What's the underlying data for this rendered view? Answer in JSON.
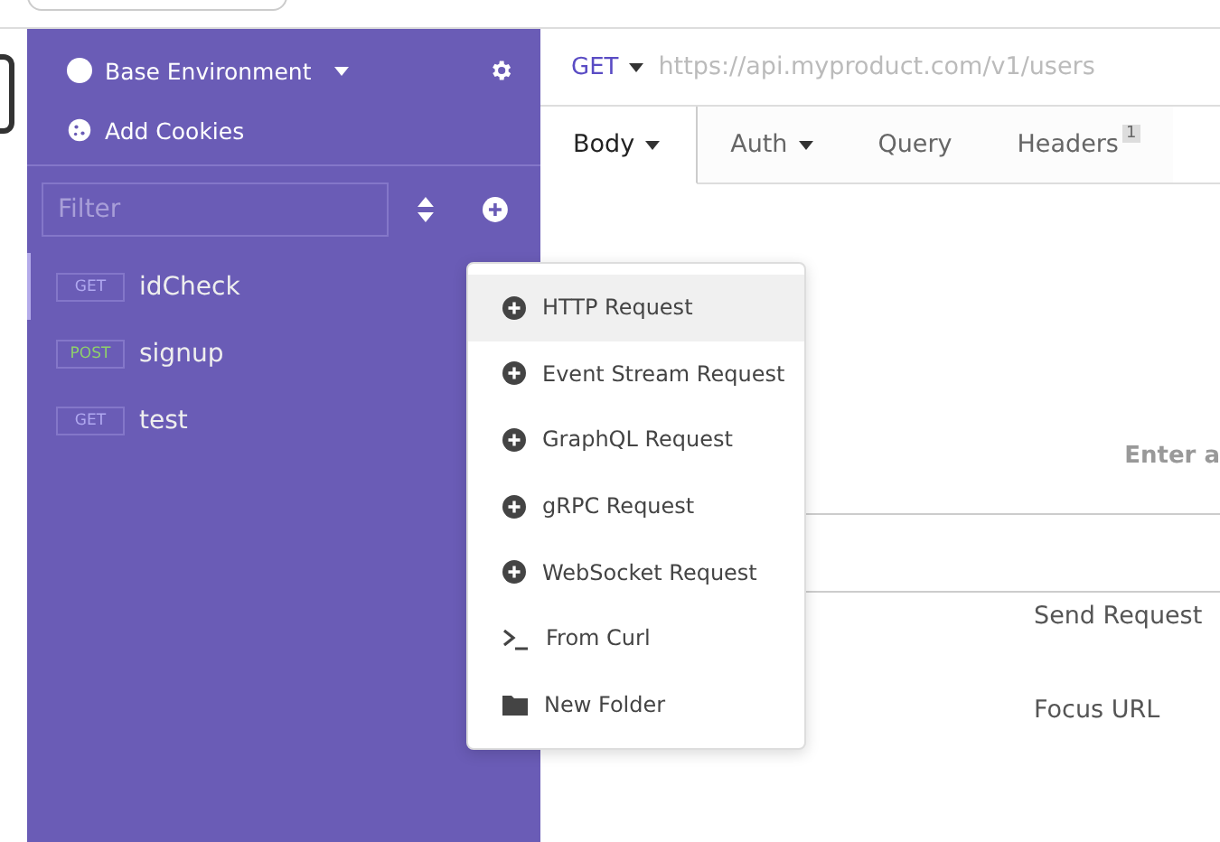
{
  "sidebar": {
    "environment": "Base Environment",
    "cookies": "Add Cookies",
    "filter": {
      "placeholder": "Filter"
    },
    "requests": [
      {
        "method": "GET",
        "name": "idCheck",
        "selected": true
      },
      {
        "method": "POST",
        "name": "signup",
        "selected": false
      },
      {
        "method": "GET",
        "name": "test",
        "selected": false
      }
    ]
  },
  "url_bar": {
    "method": "GET",
    "placeholder": "https://api.myproduct.com/v1/users"
  },
  "tabs": [
    {
      "label": "Body",
      "dropdown": true,
      "selected": true
    },
    {
      "label": "Auth",
      "dropdown": true,
      "selected": false
    },
    {
      "label": "Query",
      "dropdown": false,
      "selected": false
    },
    {
      "label": "Headers",
      "badge": "1",
      "dropdown": false,
      "selected": false
    }
  ],
  "body_hint": "Enter a",
  "shortcuts": [
    "Send Request",
    "Focus URL"
  ],
  "menu": [
    {
      "kind": "add",
      "label": "HTTP Request",
      "selected": true
    },
    {
      "kind": "add",
      "label": "Event Stream Request",
      "selected": false
    },
    {
      "kind": "add",
      "label": "GraphQL Request",
      "selected": false
    },
    {
      "kind": "add",
      "label": "gRPC Request",
      "selected": false
    },
    {
      "kind": "add",
      "label": "WebSocket Request",
      "selected": false
    },
    {
      "kind": "terminal",
      "label": "From Curl",
      "selected": false
    },
    {
      "kind": "folder",
      "label": "New Folder",
      "selected": false
    }
  ]
}
